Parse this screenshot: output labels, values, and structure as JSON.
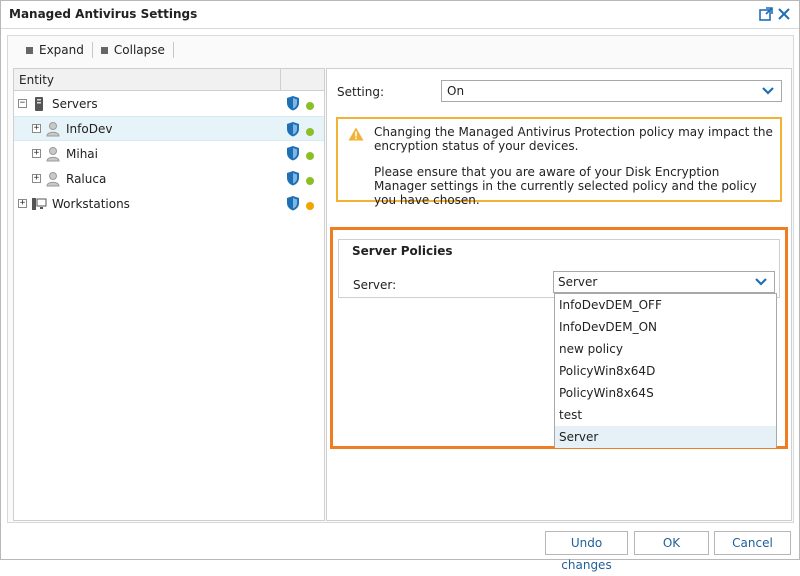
{
  "window": {
    "title": "Managed Antivirus Settings"
  },
  "toolbar": {
    "expand_label": "Expand",
    "collapse_label": "Collapse"
  },
  "entity_panel": {
    "header": "Entity",
    "items": [
      {
        "label": "Servers",
        "status_color": "#8cbf26"
      },
      {
        "label": "InfoDev",
        "status_color": "#8cbf26"
      },
      {
        "label": "Mihai",
        "status_color": "#8cbf26"
      },
      {
        "label": "Raluca",
        "status_color": "#8cbf26"
      },
      {
        "label": "Workstations",
        "status_color": "#f0a500"
      }
    ]
  },
  "settings": {
    "setting_label": "Setting:",
    "setting_value": "On",
    "warning": {
      "line1": "Changing the Managed Antivirus Protection policy may impact the encryption status of your devices.",
      "line2": "Please ensure that you are aware of your Disk Encryption Manager settings in the currently selected policy and the policy you have chosen."
    }
  },
  "server_policies": {
    "title": "Server Policies",
    "server_label": "Server:",
    "selected": "Server",
    "options": [
      "InfoDevDEM_OFF",
      "InfoDevDEM_ON",
      "new policy",
      "PolicyWin8x64D",
      "PolicyWin8x64S",
      "test",
      "Server"
    ]
  },
  "footer": {
    "undo_label": "Undo changes",
    "ok_label": "OK",
    "cancel_label": "Cancel"
  },
  "colors": {
    "accent": "#1f6fb4",
    "highlight": "#ef7d22",
    "warning_border": "#f2b233"
  }
}
